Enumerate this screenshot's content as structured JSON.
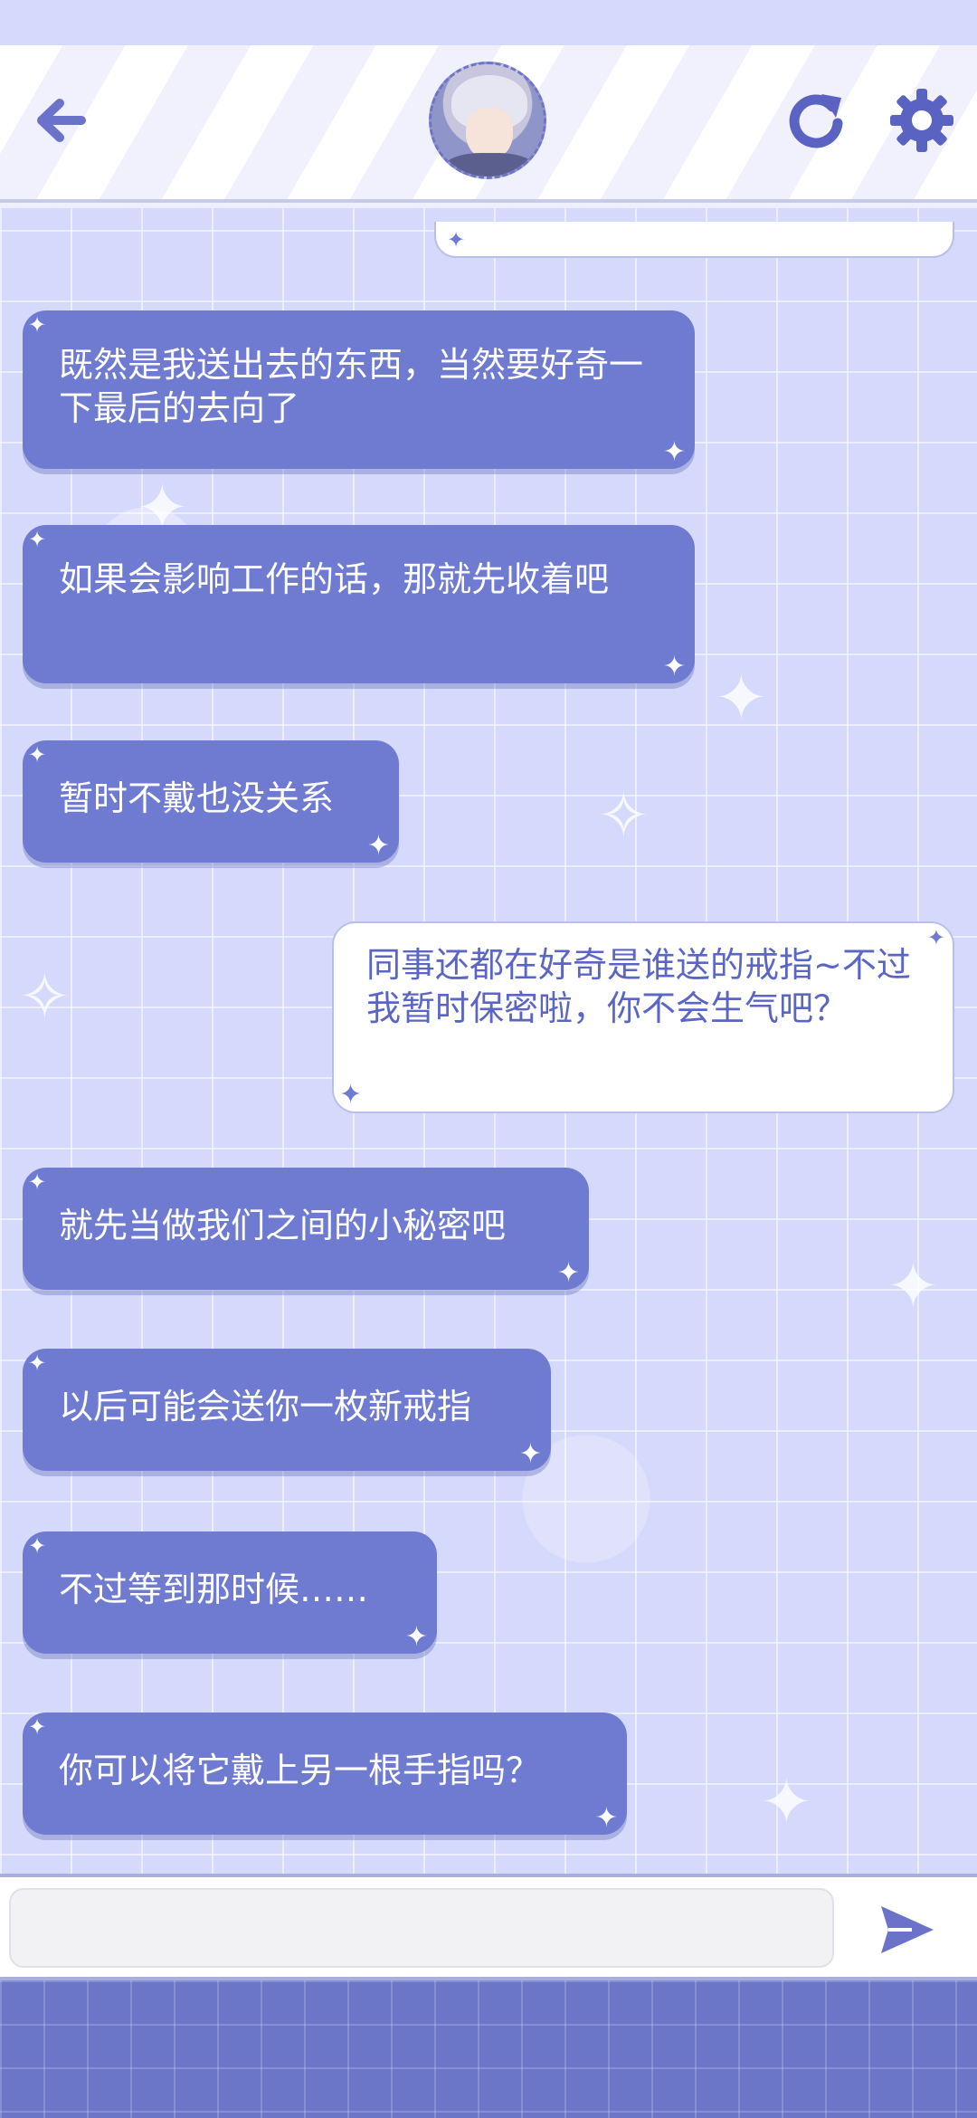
{
  "header": {
    "back_icon": "arrow-left-icon",
    "avatar": "character-avatar",
    "refresh_icon": "refresh-icon",
    "settings_icon": "gear-icon"
  },
  "messages": [
    {
      "side": "in",
      "text": "既然是我送出去的东西，当然要好奇一下最后的去向了"
    },
    {
      "side": "in",
      "text": "如果会影响工作的话，那就先收着吧"
    },
    {
      "side": "in",
      "text": "暂时不戴也没关系"
    },
    {
      "side": "out",
      "text": "同事还都在好奇是谁送的戒指~不过我暂时保密啦，你不会生气吧？"
    },
    {
      "side": "in",
      "text": "就先当做我们之间的小秘密吧"
    },
    {
      "side": "in",
      "text": "以后可能会送你一枚新戒指"
    },
    {
      "side": "in",
      "text": "不过等到那时候……"
    },
    {
      "side": "in",
      "text": "你可以将它戴上另一根手指吗？"
    }
  ],
  "input": {
    "value": "",
    "placeholder": ""
  },
  "colors": {
    "accent": "#6f7bd1",
    "outgoing_text": "#5b66c4",
    "background": "#d5d9fb"
  }
}
